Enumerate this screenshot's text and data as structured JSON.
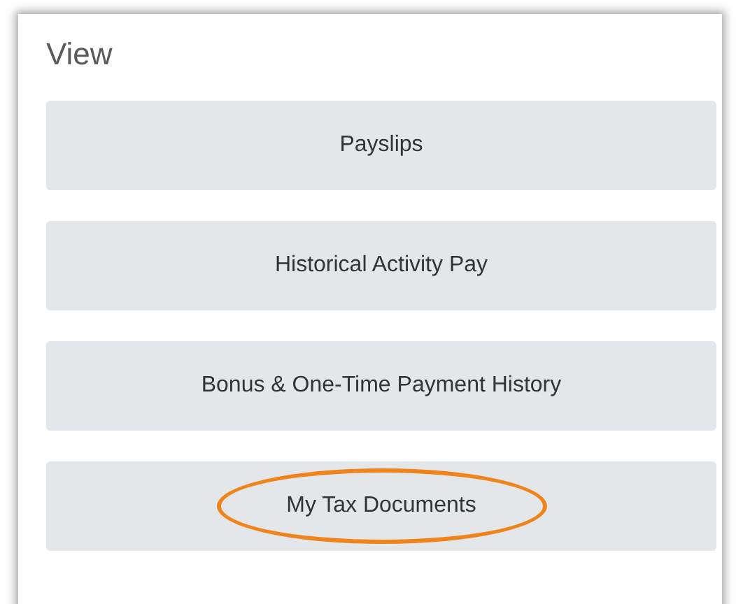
{
  "panel": {
    "title": "View"
  },
  "buttons": [
    {
      "label": "Payslips",
      "highlighted": false
    },
    {
      "label": "Historical Activity Pay",
      "highlighted": false
    },
    {
      "label": "Bonus & One-Time Payment History",
      "highlighted": false
    },
    {
      "label": "My Tax Documents",
      "highlighted": true
    }
  ]
}
